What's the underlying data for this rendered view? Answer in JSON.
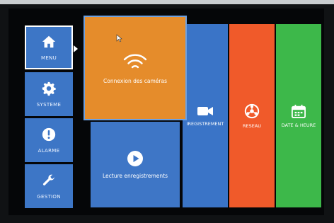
{
  "sidebar": {
    "items": [
      {
        "label": "MENU",
        "icon": "home-icon",
        "selected": true
      },
      {
        "label": "SYSTEME",
        "icon": "gear-icon",
        "selected": false
      },
      {
        "label": "ALARME",
        "icon": "alert-icon",
        "selected": false
      },
      {
        "label": "GESTION",
        "icon": "wrench-icon",
        "selected": false
      }
    ]
  },
  "tiles": {
    "camera_connection": {
      "label": "Connexion des caméras",
      "icon": "wifi-icon",
      "color": "#e58c2b"
    },
    "playback": {
      "label": "Lecture enregistrements",
      "icon": "play-icon",
      "color": "#3e76c6"
    },
    "recording": {
      "label": "IREGISTREMENT",
      "icon": "video-camera-icon",
      "color": "#3a74c7"
    },
    "network": {
      "label": "RESEAU",
      "icon": "network-icon",
      "color": "#f05a2a"
    },
    "datetime": {
      "label": "DATE & HEURE",
      "icon": "calendar-icon",
      "color": "#3db84a"
    }
  }
}
